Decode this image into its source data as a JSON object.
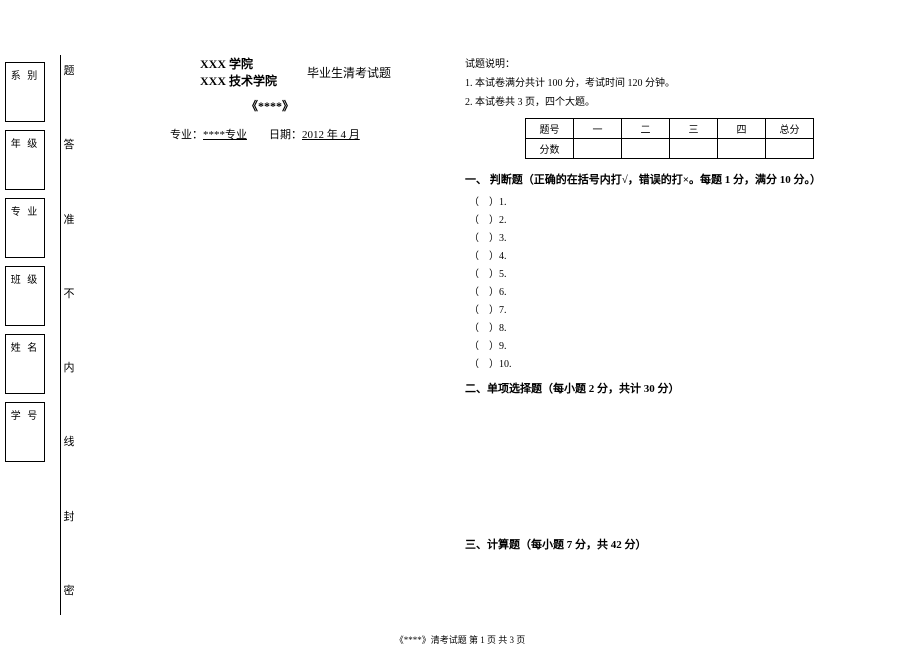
{
  "info_labels": {
    "dept": "系 别",
    "grade": "年 级",
    "major": "专 业",
    "class": "班 级",
    "name": "姓 名",
    "id": "学 号"
  },
  "seal_chars": [
    "题",
    "答",
    "准",
    "不",
    "内",
    "线",
    "封",
    "密"
  ],
  "college1": "XXX 学院",
  "college2": "XXX 技术学院",
  "exam_title": "毕业生清考试题",
  "course": "《****》",
  "major_label": "专业：",
  "major_value": "****专业",
  "date_label": "日期：",
  "date_value": "2012 年 4 月",
  "instr_title": "试题说明：",
  "instr_1": "1. 本试卷满分共计 100 分，考试时间 120 分钟。",
  "instr_2": "2. 本试卷共 3 页，四个大题。",
  "table_headers": {
    "th": "题号",
    "c1": "一",
    "c2": "二",
    "c3": "三",
    "c4": "四",
    "total": "总分",
    "score": "分数"
  },
  "section1": "一、 判断题（正确的在括号内打√，错误的打×。每题 1 分，满分 10 分。）",
  "questions": [
    "（　）1.",
    "（　）2.",
    "（　）3.",
    "（　）4.",
    "（　）5.",
    "（　）6.",
    "（　）7.",
    "（　）8.",
    "（　）9.",
    "（　）10."
  ],
  "section2": "二、单项选择题（每小题 2 分，共计 30 分）",
  "section3": "三、计算题（每小题 7 分，共 42 分）",
  "footer": "《****》清考试题 第 1 页 共 3 页"
}
